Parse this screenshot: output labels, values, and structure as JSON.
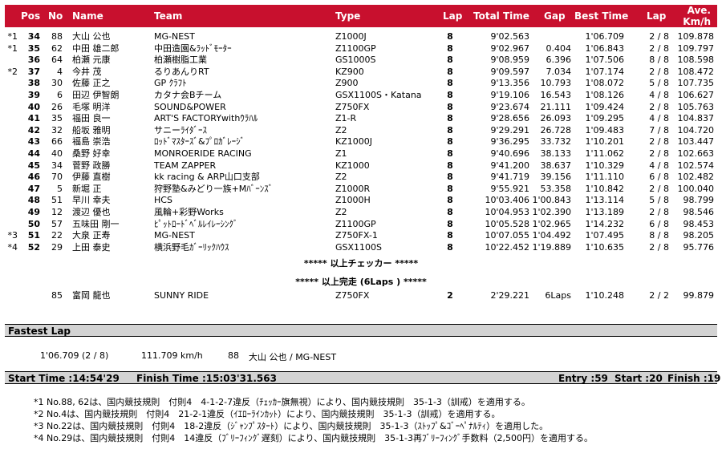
{
  "header": {
    "pos": "Pos",
    "no": "No",
    "name": "Name",
    "team": "Team",
    "type": "Type",
    "lap": "Lap",
    "total_time": "Total Time",
    "gap": "Gap",
    "best_time": "Best Time",
    "best_lap": "Lap",
    "ave_line1": "Ave.",
    "ave_line2": "Km/h"
  },
  "rows": [
    {
      "mark": "*1",
      "pos": "34",
      "no": "88",
      "name": "大山 公也",
      "team": "MG-NEST",
      "type": "Z1000J",
      "lap": "8",
      "total": "9'02.563",
      "gap": "",
      "best": "1'06.709",
      "blap": "2 / 8",
      "ave": "109.878"
    },
    {
      "mark": "*1",
      "pos": "35",
      "no": "62",
      "name": "中田 雄二郎",
      "team": "中田造園&ﾗｯﾄﾞﾓｰﾀｰ",
      "type": "Z1100GP",
      "lap": "8",
      "total": "9'02.967",
      "gap": "0.404",
      "best": "1'06.843",
      "blap": "2 / 8",
      "ave": "109.797"
    },
    {
      "mark": "",
      "pos": "36",
      "no": "64",
      "name": "柏瀬 元康",
      "team": "柏瀬樹脂工業",
      "type": "GS1000S",
      "lap": "8",
      "total": "9'08.959",
      "gap": "6.396",
      "best": "1'07.506",
      "blap": "8 / 8",
      "ave": "108.598"
    },
    {
      "mark": "*2",
      "pos": "37",
      "no": "4",
      "name": "今井 茂",
      "team": "るりあんりRT",
      "type": "KZ900",
      "lap": "8",
      "total": "9'09.597",
      "gap": "7.034",
      "best": "1'07.174",
      "blap": "2 / 8",
      "ave": "108.472"
    },
    {
      "mark": "",
      "pos": "38",
      "no": "30",
      "name": "佐藤 正之",
      "team": "GP ｸﾗﾌﾄ",
      "type": "Z900",
      "lap": "8",
      "total": "9'13.356",
      "gap": "10.793",
      "best": "1'08.072",
      "blap": "5 / 8",
      "ave": "107.735"
    },
    {
      "mark": "",
      "pos": "39",
      "no": "6",
      "name": "田辺 伊智朗",
      "team": "カタナ会Bチーム",
      "type": "GSX1100S・Katana",
      "lap": "8",
      "total": "9'19.106",
      "gap": "16.543",
      "best": "1'08.126",
      "blap": "4 / 8",
      "ave": "106.627"
    },
    {
      "mark": "",
      "pos": "40",
      "no": "26",
      "name": "毛塚 明洋",
      "team": "SOUND&POWER",
      "type": "Z750FX",
      "lap": "8",
      "total": "9'23.674",
      "gap": "21.111",
      "best": "1'09.424",
      "blap": "2 / 8",
      "ave": "105.763"
    },
    {
      "mark": "",
      "pos": "41",
      "no": "35",
      "name": "福田 良一",
      "team": "ART'S FACTORYwithｳﾗﾊﾙ",
      "type": "Z1-R",
      "lap": "8",
      "total": "9'28.656",
      "gap": "26.093",
      "best": "1'09.295",
      "blap": "4 / 8",
      "ave": "104.837"
    },
    {
      "mark": "",
      "pos": "42",
      "no": "32",
      "name": "船坂 雅明",
      "team": "サニーﾗｲﾀﾞｰｽ",
      "type": "Z2",
      "lap": "8",
      "total": "9'29.291",
      "gap": "26.728",
      "best": "1'09.483",
      "blap": "7 / 8",
      "ave": "104.720"
    },
    {
      "mark": "",
      "pos": "43",
      "no": "66",
      "name": "福島 崇浩",
      "team": "ﾛｯﾄﾞﾏｽﾀｰｽﾞ&ﾌﾟﾛｶﾞﾚｰｼﾞ",
      "type": "KZ1000J",
      "lap": "8",
      "total": "9'36.295",
      "gap": "33.732",
      "best": "1'10.201",
      "blap": "2 / 8",
      "ave": "103.447"
    },
    {
      "mark": "",
      "pos": "44",
      "no": "40",
      "name": "桑野 好幸",
      "team": "MONROERIDE RACING",
      "type": "Z1",
      "lap": "8",
      "total": "9'40.696",
      "gap": "38.133",
      "best": "1'11.062",
      "blap": "2 / 8",
      "ave": "102.663"
    },
    {
      "mark": "",
      "pos": "45",
      "no": "34",
      "name": "菅野 政勝",
      "team": "TEAM ZAPPER",
      "type": "KZ1000",
      "lap": "8",
      "total": "9'41.200",
      "gap": "38.637",
      "best": "1'10.329",
      "blap": "4 / 8",
      "ave": "102.574"
    },
    {
      "mark": "",
      "pos": "46",
      "no": "70",
      "name": "伊藤 直樹",
      "team": "kk racing & ARP山口支部",
      "type": "Z2",
      "lap": "8",
      "total": "9'41.719",
      "gap": "39.156",
      "best": "1'11.110",
      "blap": "6 / 8",
      "ave": "102.482"
    },
    {
      "mark": "",
      "pos": "47",
      "no": "5",
      "name": "新堀 正",
      "team": "狩野塾&みどり一族+Mﾊﾞｰﾝｽﾞ",
      "type": "Z1000R",
      "lap": "8",
      "total": "9'55.921",
      "gap": "53.358",
      "best": "1'10.842",
      "blap": "2 / 8",
      "ave": "100.040"
    },
    {
      "mark": "",
      "pos": "48",
      "no": "51",
      "name": "早川 幸夫",
      "team": "HCS",
      "type": "Z1000H",
      "lap": "8",
      "total": "10'03.406",
      "gap": "1'00.843",
      "best": "1'13.114",
      "blap": "5 / 8",
      "ave": "98.799"
    },
    {
      "mark": "",
      "pos": "49",
      "no": "12",
      "name": "渡辺 優也",
      "team": "風輪+彩野Works",
      "type": "Z2",
      "lap": "8",
      "total": "10'04.953",
      "gap": "1'02.390",
      "best": "1'13.189",
      "blap": "2 / 8",
      "ave": "98.546"
    },
    {
      "mark": "",
      "pos": "50",
      "no": "57",
      "name": "五味田 剛一",
      "team": "ﾋﾟｯﾄﾛｰﾄﾞﾍﾞﾙﾚｲﾚｰｼﾝｸﾞ",
      "type": "Z1100GP",
      "lap": "8",
      "total": "10'05.528",
      "gap": "1'02.965",
      "best": "1'14.232",
      "blap": "6 / 8",
      "ave": "98.453"
    },
    {
      "mark": "*3",
      "pos": "51",
      "no": "22",
      "name": "大泉 正寿",
      "team": "MG-NEST",
      "type": "Z750FX-1",
      "lap": "8",
      "total": "10'07.055",
      "gap": "1'04.492",
      "best": "1'07.495",
      "blap": "8 / 8",
      "ave": "98.205"
    },
    {
      "mark": "*4",
      "pos": "52",
      "no": "29",
      "name": "上田 泰史",
      "team": "横浜野毛ｶﾞｰﾘｯｸﾊｳｽ",
      "type": "GSX1100S",
      "lap": "8",
      "total": "10'22.452",
      "gap": "1'19.889",
      "best": "1'10.635",
      "blap": "2 / 8",
      "ave": "95.776"
    }
  ],
  "checker_banner": "***** 以上チェッカー *****",
  "finish_banner": "***** 以上完走 (6Laps ) *****",
  "extra_row": {
    "mark": "",
    "pos": "",
    "no": "85",
    "name": "富岡 龍也",
    "team": "SUNNY RIDE",
    "type": "Z750FX",
    "lap": "2",
    "total": "2'29.221",
    "gap": "6Laps",
    "best": "1'10.248",
    "blap": "2 / 2",
    "ave": "99.879"
  },
  "fastest_lap": {
    "title": "Fastest Lap",
    "time": "1'06.709 (2 / 8)",
    "speed": "111.709 km/h",
    "no": "88",
    "rider": "大山 公也 / MG-NEST"
  },
  "times": {
    "start": "Start Time :14:54'29",
    "finish": "Finish Time :15:03'31.563",
    "entry": "Entry :59",
    "started": "Start :20",
    "finished": "Finish :19"
  },
  "notes": [
    "*1 No.88, 62は、国内競技規則　付則4　4-1-2-7違反（ﾁｪｯｶｰ旗無視）により、国内競技規則　35-1-3（訓戒）を適用する。",
    "*2 No.4は、国内競技規則　付則4　21-2-1違反（ｲｴﾛｰﾗｲﾝｶｯﾄ）により、国内競技規則　35-1-3（訓戒）を適用する。",
    "*3 No.22は、国内競技規則　付則4　18-2違反（ｼﾞｬﾝﾌﾟｽﾀｰﾄ）により、国内競技規則　35-1-3（ｽﾄｯﾌﾟ&ｺﾞｰﾍﾟﾅﾙﾃｨ）を適用した。",
    "*4 No.29は、国内競技規則　付則4　14違反（ﾌﾞﾘｰﾌｨﾝｸﾞ遅刻）により、国内競技規則　35-1-3再ﾌﾞﾘｰﾌｨﾝｸﾞ手数料（2,500円）を適用する。"
  ]
}
